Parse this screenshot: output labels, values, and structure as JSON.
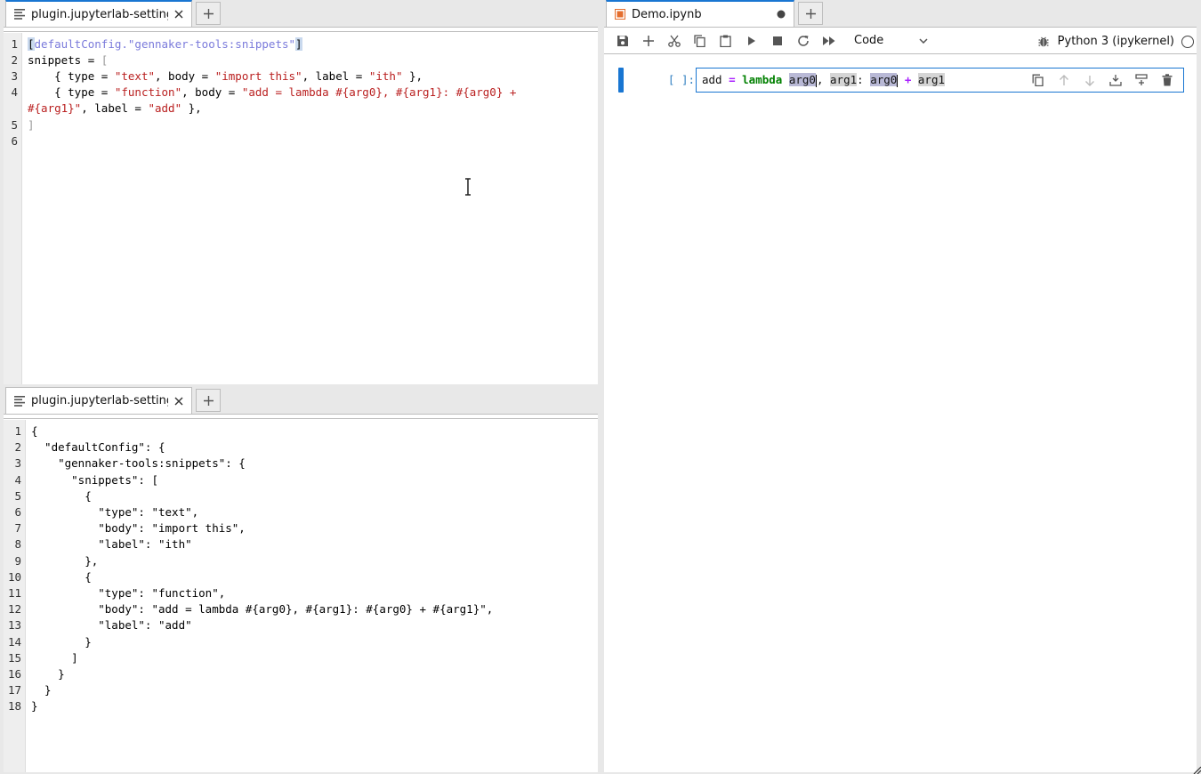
{
  "top_left": {
    "tab_label": "plugin.jupyterlab-settings.t",
    "lines": [
      {
        "n": "1"
      },
      {
        "n": "2"
      },
      {
        "n": "3"
      },
      {
        "n": "4"
      },
      {
        "n": "5"
      },
      {
        "n": "6"
      }
    ],
    "code": {
      "l1_open": "[",
      "l1_header": "defaultConfig.\"gennaker-tools:snippets\"",
      "l1_close": "]",
      "l2_key": "snippets = ",
      "l2_bracket": "[",
      "l3_a": "    { type = ",
      "l3_s1": "\"text\"",
      "l3_b": ", body = ",
      "l3_s2": "\"import this\"",
      "l3_c": ", label = ",
      "l3_s3": "\"ith\"",
      "l3_d": " },",
      "l4_a": "    { type = ",
      "l4_s1": "\"function\"",
      "l4_b": ", body = ",
      "l4_s2": "\"add = lambda #{arg0}, #{arg1}: #{arg0} +",
      "l4w_s": "#{arg1}\"",
      "l4w_b": ", label = ",
      "l4w_s3": "\"add\"",
      "l4w_c": " },",
      "l5": "]"
    }
  },
  "bottom_left": {
    "tab_label": "plugin.jupyterlab-settings",
    "lines": [
      "1",
      "2",
      "3",
      "4",
      "5",
      "6",
      "7",
      "8",
      "9",
      "10",
      "11",
      "12",
      "13",
      "14",
      "15",
      "16",
      "17",
      "18"
    ],
    "code": [
      "{",
      "  \"defaultConfig\": {",
      "    \"gennaker-tools:snippets\": {",
      "      \"snippets\": [",
      "        {",
      "          \"type\": \"text\",",
      "          \"body\": \"import this\",",
      "          \"label\": \"ith\"",
      "        },",
      "        {",
      "          \"type\": \"function\",",
      "          \"body\": \"add = lambda #{arg0}, #{arg1}: #{arg0} + #{arg1}\",",
      "          \"label\": \"add\"",
      "        }",
      "      ]",
      "    }",
      "  }",
      "}"
    ]
  },
  "notebook": {
    "tab_label": "Demo.ipynb",
    "cell_type": "Code",
    "kernel_name": "Python 3 (ipykernel)",
    "prompt": "[ ]:",
    "cell": {
      "v1": "add",
      "eq": " = ",
      "kw": "lambda",
      "sp": " ",
      "arg0a": "arg0",
      "comma": ", ",
      "arg1a": "arg1",
      "colon": ": ",
      "arg0b": "arg0",
      "plus_sp1": " ",
      "plus": "+",
      "plus_sp2": " ",
      "arg1b": "arg1"
    }
  },
  "colors": {
    "accent": "#1976d2",
    "string": "#ba2121",
    "keyword": "#008000",
    "operator": "#aa22ff"
  }
}
